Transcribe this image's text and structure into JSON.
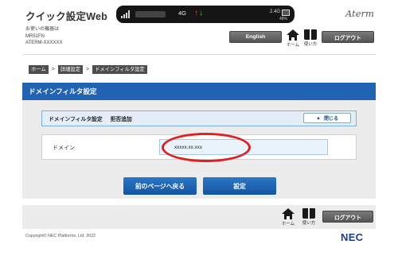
{
  "header": {
    "app_title": "クイック設定Web",
    "device_info_lines": [
      "お使いの機器は",
      "MR51FN",
      "ATERM-XXXXXX"
    ],
    "brand": "Aterm",
    "status": {
      "network": "4G",
      "frequency": "2.4G",
      "battery": "48%"
    },
    "english_button": "English",
    "home_label": "ホーム",
    "help_label": "使い方",
    "logout_button": "ログアウト"
  },
  "breadcrumb": [
    "ホーム",
    "詳細設定",
    "ドメインフィルタ設定"
  ],
  "breadcrumb_separator": ">",
  "section": {
    "title": "ドメインフィルタ設定",
    "subheader_title": "ドメインフィルタ設定",
    "subheader_mode": "拒否追加",
    "close_button": "閉じる"
  },
  "form": {
    "domain_label": "ドメイン",
    "domain_value": "xxxxx.xx.xxx"
  },
  "actions": {
    "back_button": "前のページへ戻る",
    "submit_button": "設定"
  },
  "footer": {
    "home_label": "ホーム",
    "help_label": "使い方",
    "logout_button": "ログアウト",
    "copyright": "Copyright© NEC Platforms, Ltd. 2022",
    "nec_logo": "NEC"
  },
  "colors": {
    "section_blue": "#2063b3",
    "button_blue": "#1a63b4",
    "highlight_red": "#e02020",
    "nec_blue": "#1b3f95"
  }
}
